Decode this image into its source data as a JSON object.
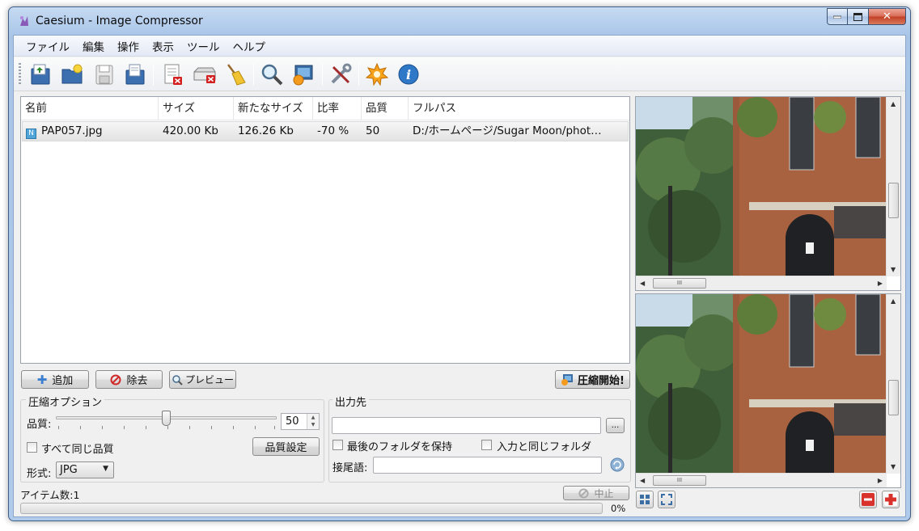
{
  "window": {
    "title": "Caesium - Image Compressor"
  },
  "menu": [
    "ファイル",
    "編集",
    "操作",
    "表示",
    "ツール",
    "ヘルプ"
  ],
  "toolbar": [
    {
      "name": "open-file-icon"
    },
    {
      "name": "open-folder-icon"
    },
    {
      "name": "save-list-icon"
    },
    {
      "name": "import-list-icon"
    },
    {
      "name": "remove-item-icon"
    },
    {
      "name": "clear-list-icon"
    },
    {
      "name": "clean-broom-icon"
    },
    {
      "name": "zoom-search-icon"
    },
    {
      "name": "preview-image-icon"
    },
    {
      "name": "settings-tools-icon"
    },
    {
      "name": "update-star-icon"
    },
    {
      "name": "info-icon"
    }
  ],
  "file_list": {
    "columns": [
      "名前",
      "サイズ",
      "新たなサイズ",
      "比率",
      "品質",
      "フルパス"
    ],
    "rows": [
      {
        "icon_letter": "N",
        "name": "PAP057.jpg",
        "size": "420.00 Kb",
        "new_size": "126.26 Kb",
        "ratio": "-70 %",
        "quality": "50",
        "path": "D:/ホームページ/Sugar Moon/phot…"
      }
    ]
  },
  "buttons": {
    "add": "追加",
    "remove": "除去",
    "preview": "プレビュー",
    "compress": "圧縮開始!"
  },
  "options": {
    "title": "圧縮オプション",
    "quality_label": "品質:",
    "quality_value": "50",
    "quality_fraction": 0.5,
    "same_quality_label": "すべて同じ品質",
    "quality_settings_button": "品質設定",
    "format_label": "形式:",
    "format_value": "JPG"
  },
  "output": {
    "title": "出力先",
    "path_value": "",
    "browse_button": "...",
    "keep_last_folder_label": "最後のフォルダを保持",
    "same_as_input_label": "入力と同じフォルダ",
    "suffix_label": "接尾語:",
    "suffix_value": ""
  },
  "status": {
    "items_label": "アイテム数:1",
    "stop_button": "中止",
    "progress_text": "0%",
    "progress_fraction": 0
  }
}
